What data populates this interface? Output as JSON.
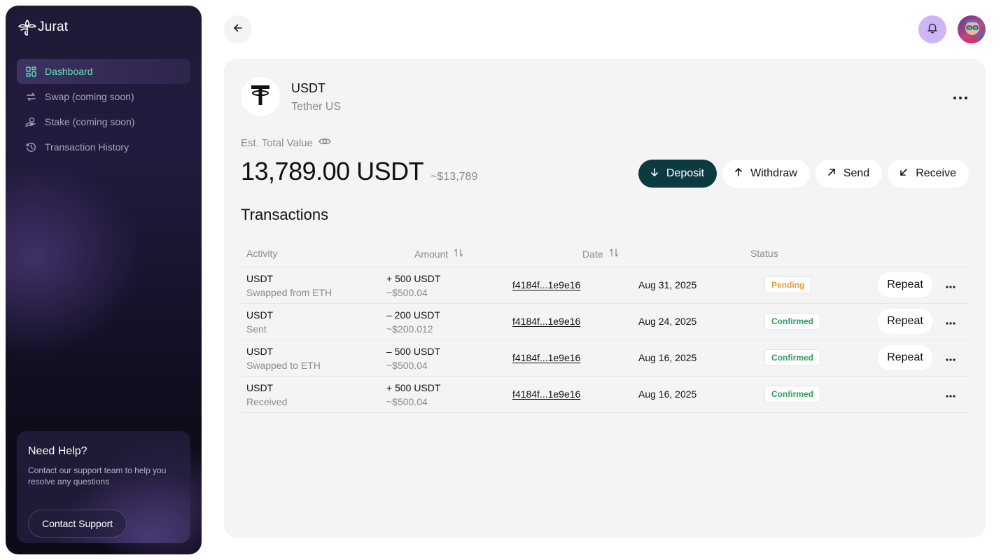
{
  "brand": {
    "name": "Jurat"
  },
  "sidebar": {
    "items": [
      {
        "label": "Dashboard",
        "icon": "dashboard-grid-icon",
        "active": true
      },
      {
        "label": "Swap (coming soon)",
        "icon": "swap-arrows-icon",
        "active": false
      },
      {
        "label": "Stake (coming soon)",
        "icon": "stake-coins-icon",
        "active": false
      },
      {
        "label": "Transaction History",
        "icon": "history-clock-icon",
        "active": false
      }
    ],
    "help": {
      "title": "Need Help?",
      "description": "Contact our support team to help you resolve any questions",
      "button": "Contact Support"
    }
  },
  "header": {
    "back_icon": "arrow-left-icon",
    "bell_icon": "bell-icon",
    "bell_color": "#cdb6f3"
  },
  "token": {
    "symbol": "USDT",
    "name": "Tether US",
    "icon": "tether-logo-icon"
  },
  "balance": {
    "label": "Est. Total Value",
    "value": "13,789.00 USDT",
    "fiat": "~$13,789"
  },
  "actions": {
    "deposit": "Deposit",
    "withdraw": "Withdraw",
    "send": "Send",
    "receive": "Receive"
  },
  "transactions": {
    "title": "Transactions",
    "columns": {
      "activity": "Activity",
      "amount": "Amount",
      "date": "Date",
      "status": "Status"
    },
    "rows": [
      {
        "asset": "USDT",
        "desc": "Swapped from ETH",
        "amount": "+ 500 USDT",
        "fiat": "~$500.04",
        "hash": "f4184f...1e9e16",
        "date": "Aug 31, 2025",
        "status": "Pending",
        "repeat": "Repeat"
      },
      {
        "asset": "USDT",
        "desc": "Sent",
        "amount": "– 200 USDT",
        "fiat": "~$200.012",
        "hash": "f4184f...1e9e16",
        "date": "Aug 24, 2025",
        "status": "Confirmed",
        "repeat": "Repeat"
      },
      {
        "asset": "USDT",
        "desc": "Swapped to ETH",
        "amount": "– 500 USDT",
        "fiat": "~$500.04",
        "hash": "f4184f...1e9e16",
        "date": "Aug 16, 2025",
        "status": "Confirmed",
        "repeat": "Repeat"
      },
      {
        "asset": "USDT",
        "desc": "Received",
        "amount": "+ 500 USDT",
        "fiat": "~$500.04",
        "hash": "f4184f...1e9e16",
        "date": "Aug 16, 2025",
        "status": "Confirmed",
        "repeat": null
      }
    ]
  },
  "colors": {
    "accent_active": "#5fe0b0",
    "primary_button": "#0b3b41",
    "pending": "#e89a3c",
    "confirmed": "#2f9a5e"
  }
}
